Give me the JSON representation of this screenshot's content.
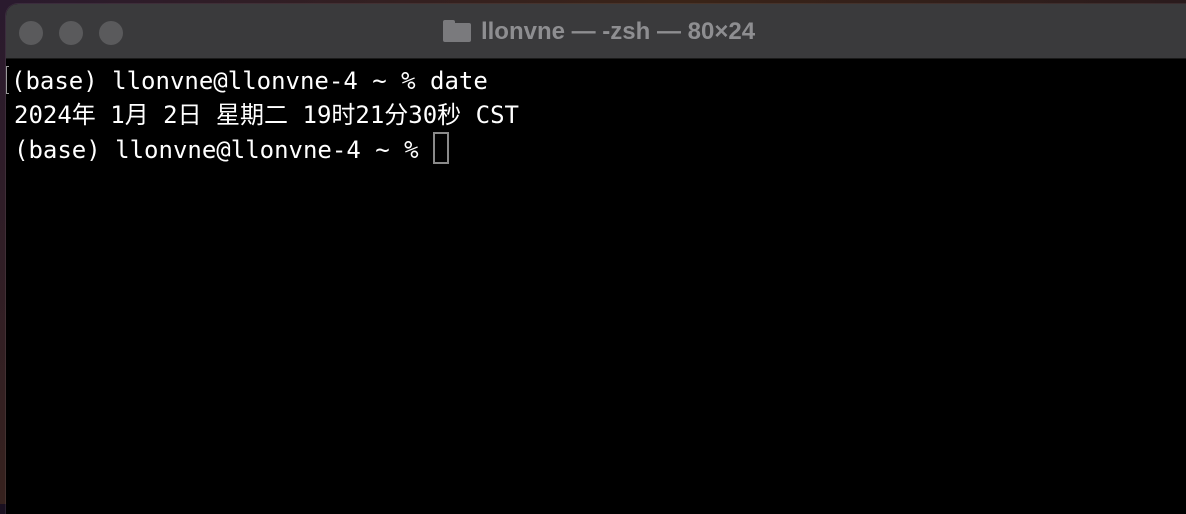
{
  "window": {
    "title": "llonvne — -zsh — 80×24"
  },
  "terminal": {
    "lines": [
      {
        "prompt": "(base) llonvne@llonvne-4 ~ %",
        "command": "date"
      },
      {
        "output": "2024年 1月 2日 星期二 19时21分30秒 CST"
      },
      {
        "prompt": "(base) llonvne@llonvne-4 ~ %",
        "command": ""
      }
    ]
  },
  "icons": {
    "title_icon": "folder-icon",
    "cursor": "block-cursor"
  }
}
